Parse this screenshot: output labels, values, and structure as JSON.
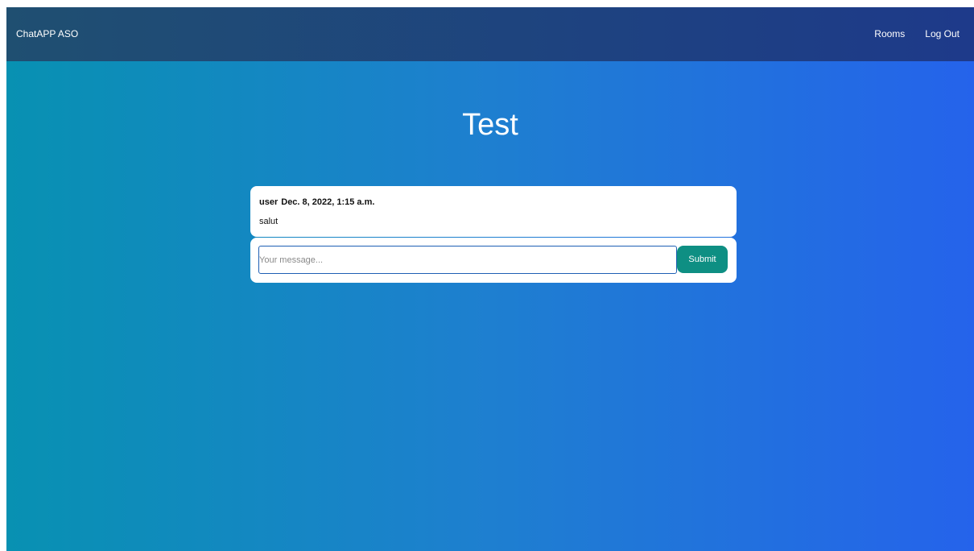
{
  "navbar": {
    "brand": "ChatAPP ASO",
    "links": [
      "Rooms",
      "Log Out"
    ]
  },
  "room": {
    "title": "Test"
  },
  "messages": [
    {
      "user": "user",
      "timestamp": "Dec. 8, 2022, 1:15 a.m.",
      "text": "salut"
    }
  ],
  "composer": {
    "placeholder": "Your message...",
    "value": "",
    "submit_label": "Submit"
  },
  "colors": {
    "navbar_start": "#1f4f71",
    "navbar_end": "#1e3a8a",
    "background_start": "#0891b2",
    "background_end": "#2563eb",
    "submit_button": "#0e8f83",
    "input_border": "#1e5fb4"
  }
}
